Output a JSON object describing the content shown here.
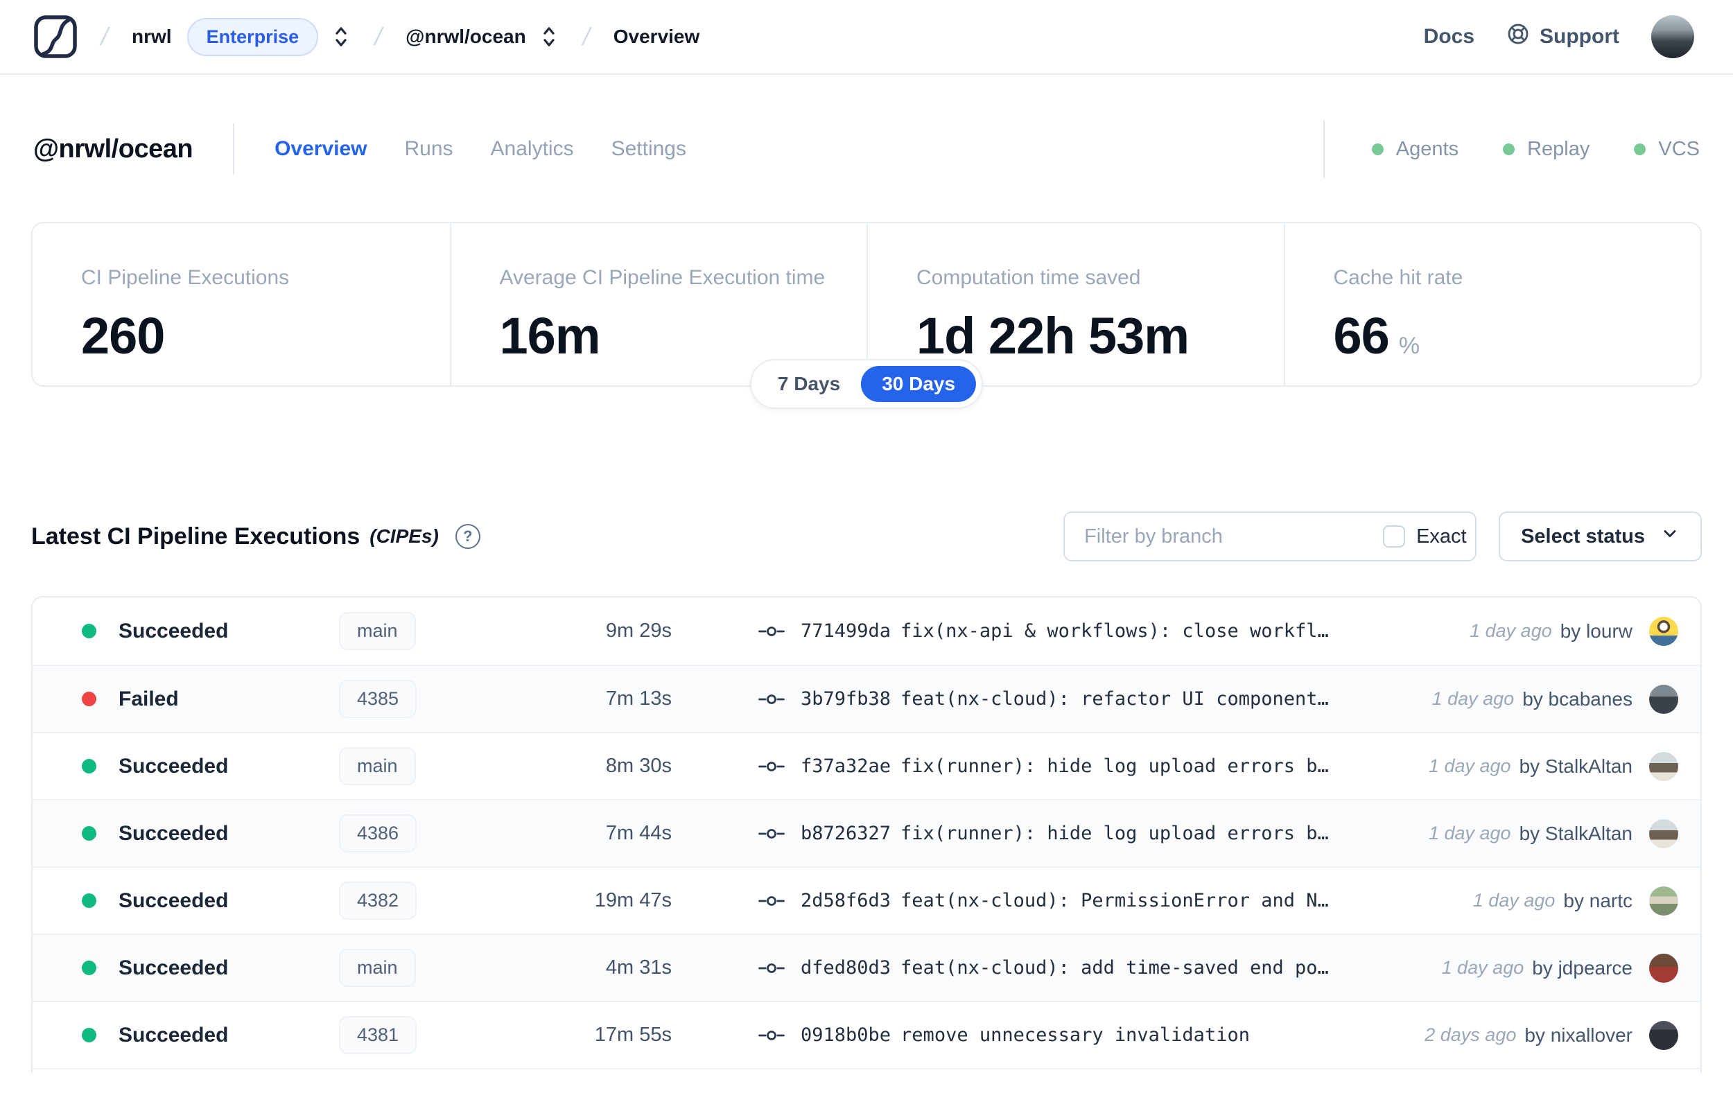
{
  "colors": {
    "accent_blue": "#2563eb",
    "success_green": "#10b981",
    "failure_red": "#ef4444",
    "service_green": "#77c996"
  },
  "topbar": {
    "breadcrumb": {
      "org": "nrwl",
      "plan_badge": "Enterprise",
      "workspace": "@nrwl/ocean",
      "page": "Overview"
    },
    "docs_label": "Docs",
    "support_label": "Support"
  },
  "workspace_header": {
    "title": "@nrwl/ocean",
    "tabs": [
      {
        "label": "Overview",
        "active": true
      },
      {
        "label": "Runs",
        "active": false
      },
      {
        "label": "Analytics",
        "active": false
      },
      {
        "label": "Settings",
        "active": false
      }
    ],
    "services": [
      {
        "label": "Agents"
      },
      {
        "label": "Replay"
      },
      {
        "label": "VCS"
      }
    ]
  },
  "stats": {
    "cards": [
      {
        "label": "CI Pipeline Executions",
        "value": "260"
      },
      {
        "label": "Average CI Pipeline Execution time",
        "value": "16m"
      },
      {
        "label": "Computation time saved",
        "value": "1d 22h 53m"
      },
      {
        "label": "Cache hit rate",
        "value": "66",
        "suffix": "%"
      }
    ],
    "range_toggle": {
      "options": [
        "7 Days",
        "30 Days"
      ],
      "selected": "30 Days"
    }
  },
  "cipe_section": {
    "title": "Latest CI Pipeline Executions",
    "subtitle": "(CIPEs)",
    "filter": {
      "placeholder": "Filter by branch",
      "exact_label": "Exact"
    },
    "status_select_label": "Select status",
    "rows": [
      {
        "status": "Succeeded",
        "status_color": "green",
        "branch": "main",
        "duration": "9m 29s",
        "commit": "771499da",
        "message": "fix(nx-api & workflows): close workfl…",
        "time_ago": "1 day ago",
        "author": "by lourw"
      },
      {
        "status": "Failed",
        "status_color": "red",
        "branch": "4385",
        "duration": "7m 13s",
        "commit": "3b79fb38",
        "message": "feat(nx-cloud): refactor UI component…",
        "time_ago": "1 day ago",
        "author": "by bcabanes"
      },
      {
        "status": "Succeeded",
        "status_color": "green",
        "branch": "main",
        "duration": "8m 30s",
        "commit": "f37a32ae",
        "message": "fix(runner): hide log upload errors b…",
        "time_ago": "1 day ago",
        "author": "by StalkAltan"
      },
      {
        "status": "Succeeded",
        "status_color": "green",
        "branch": "4386",
        "duration": "7m 44s",
        "commit": "b8726327",
        "message": "fix(runner): hide log upload errors b…",
        "time_ago": "1 day ago",
        "author": "by StalkAltan"
      },
      {
        "status": "Succeeded",
        "status_color": "green",
        "branch": "4382",
        "duration": "19m 47s",
        "commit": "2d58f6d3",
        "message": "feat(nx-cloud): PermissionError and N…",
        "time_ago": "1 day ago",
        "author": "by nartc"
      },
      {
        "status": "Succeeded",
        "status_color": "green",
        "branch": "main",
        "duration": "4m 31s",
        "commit": "dfed80d3",
        "message": "feat(nx-cloud): add time-saved end po…",
        "time_ago": "1 day ago",
        "author": "by jdpearce"
      },
      {
        "status": "Succeeded",
        "status_color": "green",
        "branch": "4381",
        "duration": "17m 55s",
        "commit": "0918b0be",
        "message": "remove unnecessary invalidation",
        "time_ago": "2 days ago",
        "author": "by nixallover"
      }
    ]
  }
}
